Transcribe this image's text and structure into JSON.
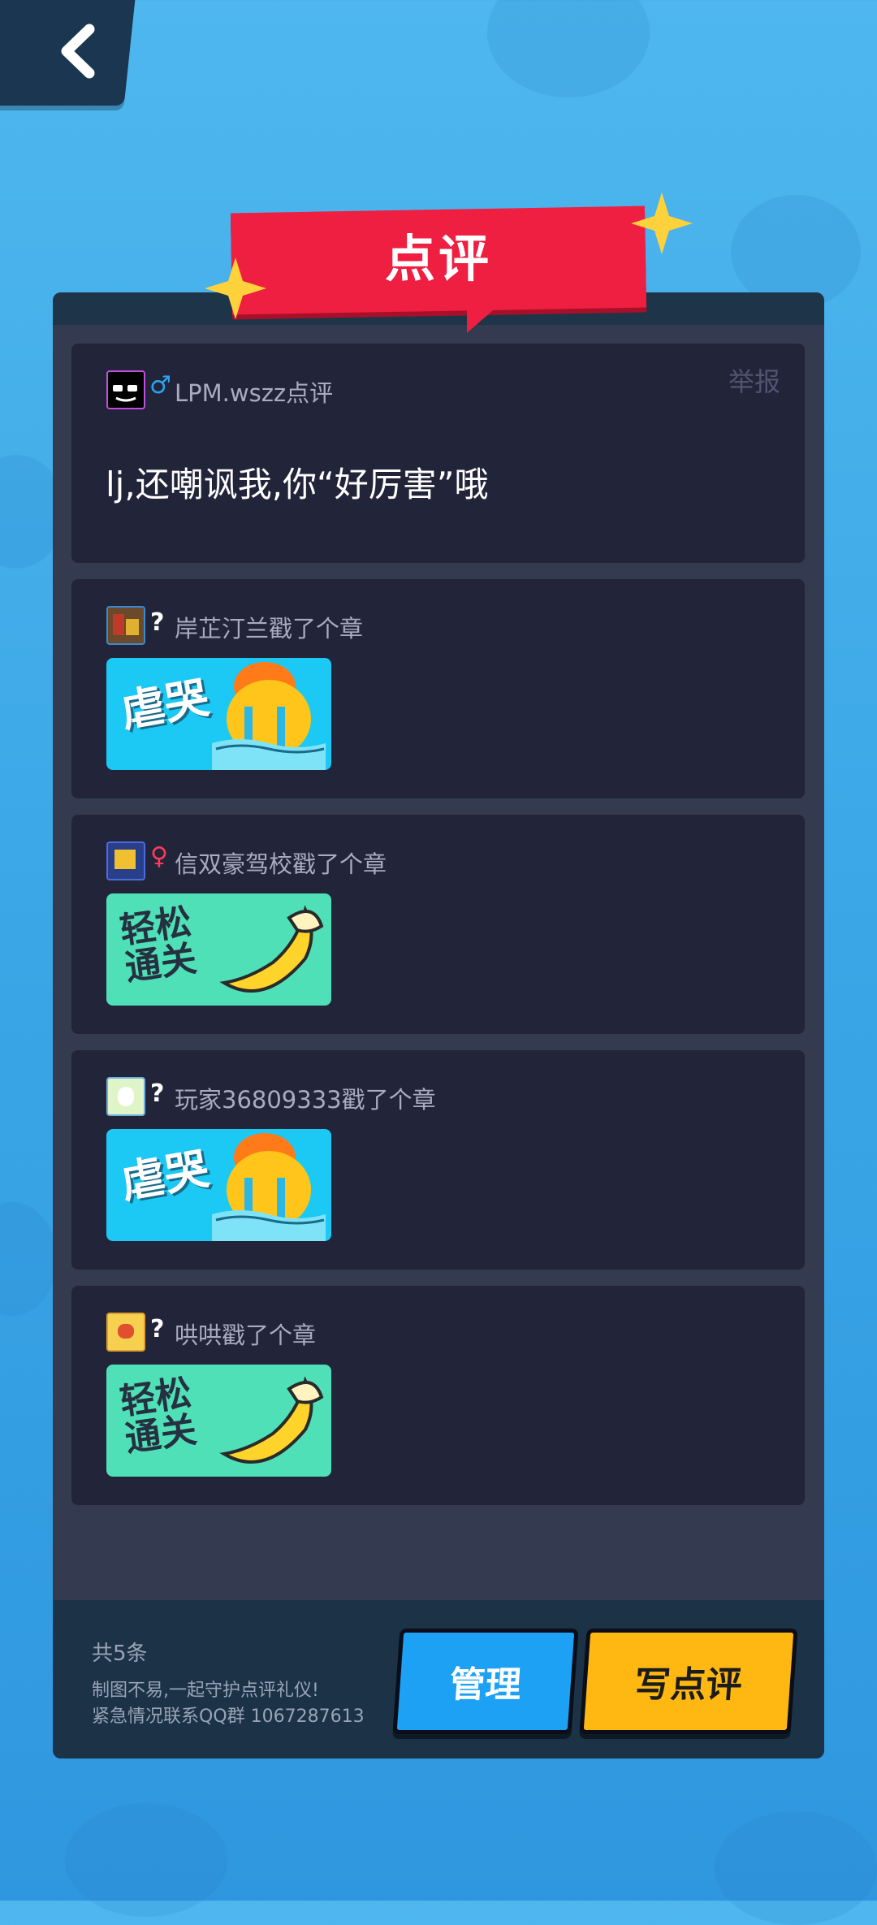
{
  "header": {
    "back_label": "",
    "title": "点评"
  },
  "main_comment": {
    "author": "LPM.wszz点评",
    "gender": "♂",
    "report_label": "举报",
    "text": "lj,还嘲讽我,你“好厉害”哦"
  },
  "stamps": [
    {
      "author": "岸芷汀兰戳了个章",
      "gender": "?",
      "sticker_text": "虐哭",
      "sticker_theme": "blue"
    },
    {
      "author": "信双豪驾校戳了个章",
      "gender": "♀",
      "sticker_text": "轻松\n通关",
      "sticker_theme": "green"
    },
    {
      "author": "玩家36809333戳了个章",
      "gender": "?",
      "sticker_text": "虐哭",
      "sticker_theme": "blue"
    },
    {
      "author": "哄哄戳了个章",
      "gender": "?",
      "sticker_text": "轻松\n通关",
      "sticker_theme": "green"
    }
  ],
  "footer": {
    "count": "共5条",
    "line1": "制图不易,一起守护点评礼仪!",
    "line2": "紧急情况联系QQ群 1067287613",
    "manage_label": "管理",
    "write_label": "写点评"
  },
  "colors": {
    "accent_red": "#ee1f41",
    "male_blue": "#2aa3f0",
    "female_red": "#ff3b5c",
    "button_blue": "#1ca1f5",
    "button_yellow": "#ffb812"
  }
}
